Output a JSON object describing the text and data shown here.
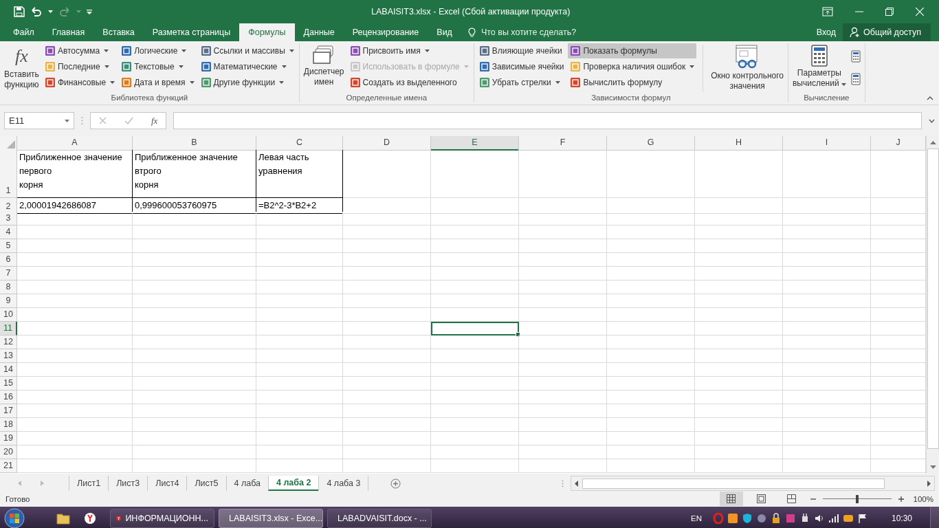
{
  "title_bar": {
    "title": "LABAISIT3.xlsx - Excel (Сбой активации продукта)"
  },
  "ribbon_tabs": [
    {
      "label": "Файл",
      "selected": false
    },
    {
      "label": "Главная",
      "selected": false
    },
    {
      "label": "Вставка",
      "selected": false
    },
    {
      "label": "Разметка страницы",
      "selected": false
    },
    {
      "label": "Формулы",
      "selected": true
    },
    {
      "label": "Данные",
      "selected": false
    },
    {
      "label": "Рецензирование",
      "selected": false
    },
    {
      "label": "Вид",
      "selected": false
    }
  ],
  "tell_me": {
    "placeholder": "Что вы хотите сделать?"
  },
  "account": {
    "sign_in": "Вход",
    "share": "Общий доступ"
  },
  "ribbon_groups": [
    {
      "label": "Библиотека функций",
      "columns": [
        {
          "kind": "large",
          "glyph": "fx",
          "label": "Вставить\nфункцию",
          "dropdown": false
        },
        {
          "kind": "column",
          "items": [
            {
              "label": "Автосумма",
              "dropdown": true
            },
            {
              "label": "Последние",
              "dropdown": true
            },
            {
              "label": "Финансовые",
              "dropdown": true
            }
          ]
        },
        {
          "kind": "column",
          "items": [
            {
              "label": "Логические",
              "dropdown": true
            },
            {
              "label": "Текстовые",
              "dropdown": true
            },
            {
              "label": "Дата и время",
              "dropdown": true
            }
          ]
        },
        {
          "kind": "column",
          "items": [
            {
              "label": "Ссылки и массивы",
              "dropdown": true
            },
            {
              "label": "Математические",
              "dropdown": true
            },
            {
              "label": "Другие функции",
              "dropdown": true
            }
          ]
        }
      ]
    },
    {
      "label": "Определенные имена",
      "columns": [
        {
          "kind": "large",
          "label": "Диспетчер\nимен",
          "dropdown": false
        },
        {
          "kind": "column",
          "items": [
            {
              "label": "Присвоить имя",
              "dropdown": true,
              "disabled": false
            },
            {
              "label": "Использовать в формуле",
              "dropdown": true,
              "disabled": true
            },
            {
              "label": "Создать из выделенного",
              "dropdown": false,
              "disabled": false
            }
          ]
        }
      ]
    },
    {
      "label": "Зависимости формул",
      "columns": [
        {
          "kind": "column",
          "items": [
            {
              "label": "Влияющие ячейки",
              "dropdown": false,
              "pressed": false
            },
            {
              "label": "Зависимые ячейки",
              "dropdown": false,
              "pressed": false
            },
            {
              "label": "Убрать стрелки",
              "dropdown": true,
              "pressed": false
            }
          ]
        },
        {
          "kind": "column",
          "items": [
            {
              "label": "Показать формулы",
              "dropdown": false,
              "pressed": true
            },
            {
              "label": "Проверка наличия ошибок",
              "dropdown": true,
              "pressed": false
            },
            {
              "label": "Вычислить формулу",
              "dropdown": false,
              "pressed": false
            }
          ]
        },
        {
          "kind": "separator"
        },
        {
          "kind": "large",
          "label": "Окно контрольного\nзначения",
          "dropdown": false
        }
      ]
    },
    {
      "label": "Вычисление",
      "columns": [
        {
          "kind": "large",
          "label": "Параметры\nвычислений",
          "dropdown": true
        },
        {
          "kind": "icon_column",
          "items": [
            {
              "pressed": false
            },
            {
              "pressed": false
            }
          ]
        }
      ]
    }
  ],
  "formula_bar": {
    "name_box": "E11",
    "fx": "fx"
  },
  "sheet": {
    "columns": [
      {
        "label": "A",
        "selected": false
      },
      {
        "label": "B",
        "selected": false
      },
      {
        "label": "C",
        "selected": false
      },
      {
        "label": "D",
        "selected": false
      },
      {
        "label": "E",
        "selected": true
      },
      {
        "label": "F",
        "selected": false
      },
      {
        "label": "G",
        "selected": false
      },
      {
        "label": "H",
        "selected": false
      },
      {
        "label": "I",
        "selected": false
      },
      {
        "label": "J",
        "selected": false
      }
    ],
    "rows": [
      {
        "header": "1",
        "selected": false,
        "cells": [
          {
            "text": "Приближенное значение\nпервого\nкорня",
            "bordered": true
          },
          {
            "text": "Приближенное значение\nвтрого\nкорня",
            "bordered": true
          },
          {
            "text": "Левая часть\nуравнения",
            "bordered": true
          }
        ]
      },
      {
        "header": "2",
        "selected": false,
        "cells": [
          {
            "text": "2,00001942686087",
            "bordered": true
          },
          {
            "text": "0,999600053760975",
            "bordered": true
          },
          {
            "text": "=B2^2-3*B2+2",
            "bordered": true
          }
        ]
      },
      {
        "header": "3",
        "selected": false
      },
      {
        "header": "4",
        "selected": false
      },
      {
        "header": "5",
        "selected": false
      },
      {
        "header": "6",
        "selected": false
      },
      {
        "header": "7",
        "selected": false
      },
      {
        "header": "8",
        "selected": false
      },
      {
        "header": "9",
        "selected": false
      },
      {
        "header": "10",
        "selected": false
      },
      {
        "header": "11",
        "selected": true
      },
      {
        "header": "12",
        "selected": false
      },
      {
        "header": "13",
        "selected": false
      },
      {
        "header": "14",
        "selected": false
      },
      {
        "header": "15",
        "selected": false
      },
      {
        "header": "16",
        "selected": false
      },
      {
        "header": "17",
        "selected": false
      },
      {
        "header": "18",
        "selected": false
      },
      {
        "header": "19",
        "selected": false
      },
      {
        "header": "20",
        "selected": false
      },
      {
        "header": "21",
        "selected": false
      }
    ]
  },
  "sheet_tabs": [
    {
      "label": "Лист1",
      "selected": false
    },
    {
      "label": "Лист3",
      "selected": false
    },
    {
      "label": "Лист4",
      "selected": false
    },
    {
      "label": "Лист5",
      "selected": false
    },
    {
      "label": "4 лаба",
      "selected": false
    },
    {
      "label": "4 лаба 2",
      "selected": true
    },
    {
      "label": "4 лаба 3",
      "selected": false
    }
  ],
  "status_bar": {
    "status": "Готово",
    "views": [
      {
        "kind": "normal",
        "selected": true
      },
      {
        "kind": "page_layout",
        "selected": false
      },
      {
        "kind": "page_break",
        "selected": false
      }
    ],
    "zoom_slider": {
      "level": 0.5
    },
    "zoom": "100%"
  },
  "taskbar": {
    "tasks": [
      {
        "label": "ИНФОРМАЦИОНН...",
        "kind": "browser",
        "selected": false
      },
      {
        "label": "LABAISIT3.xlsx - Exce...",
        "kind": "excel",
        "selected": true
      },
      {
        "label": "LABADVAISIT.docx - ...",
        "kind": "word",
        "selected": false
      }
    ],
    "language": "EN",
    "clock": "10:30"
  }
}
